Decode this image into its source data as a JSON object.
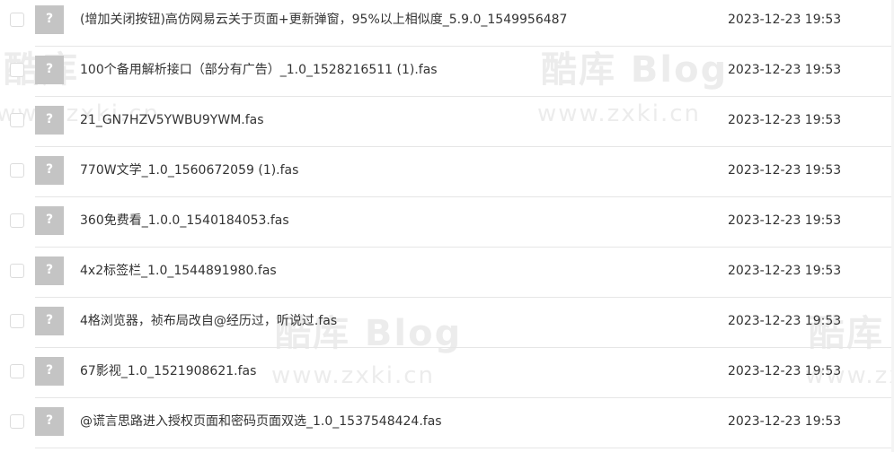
{
  "files": [
    {
      "icon": "?",
      "name": "(增加关闭按钮)高仿网易云关于页面+更新弹窗，95%以上相似度_5.9.0_1549956487.fas",
      "date": "2023-12-23 19:53"
    },
    {
      "icon": "?",
      "name": "100个备用解析接口（部分有广告）_1.0_1528216511 (1).fas",
      "date": "2023-12-23 19:53"
    },
    {
      "icon": "?",
      "name": "21_GN7HZV5YWBU9YWM.fas",
      "date": "2023-12-23 19:53"
    },
    {
      "icon": "?",
      "name": "770W文学_1.0_1560672059 (1).fas",
      "date": "2023-12-23 19:53"
    },
    {
      "icon": "?",
      "name": "360免费看_1.0.0_1540184053.fas",
      "date": "2023-12-23 19:53"
    },
    {
      "icon": "?",
      "name": "4x2标签栏_1.0_1544891980.fas",
      "date": "2023-12-23 19:53"
    },
    {
      "icon": "?",
      "name": "4格浏览器，祯布局改自@经历过，听说过.fas",
      "date": "2023-12-23 19:53"
    },
    {
      "icon": "?",
      "name": "67影视_1.0_1521908621.fas",
      "date": "2023-12-23 19:53"
    },
    {
      "icon": "?",
      "name": "@谎言思路进入授权页面和密码页面双选_1.0_1537548424.fas",
      "date": "2023-12-23 19:53"
    }
  ],
  "watermark": {
    "logo": "酷库 Blog",
    "logo_partial": "酷库",
    "url": "www.zxki.cn"
  }
}
